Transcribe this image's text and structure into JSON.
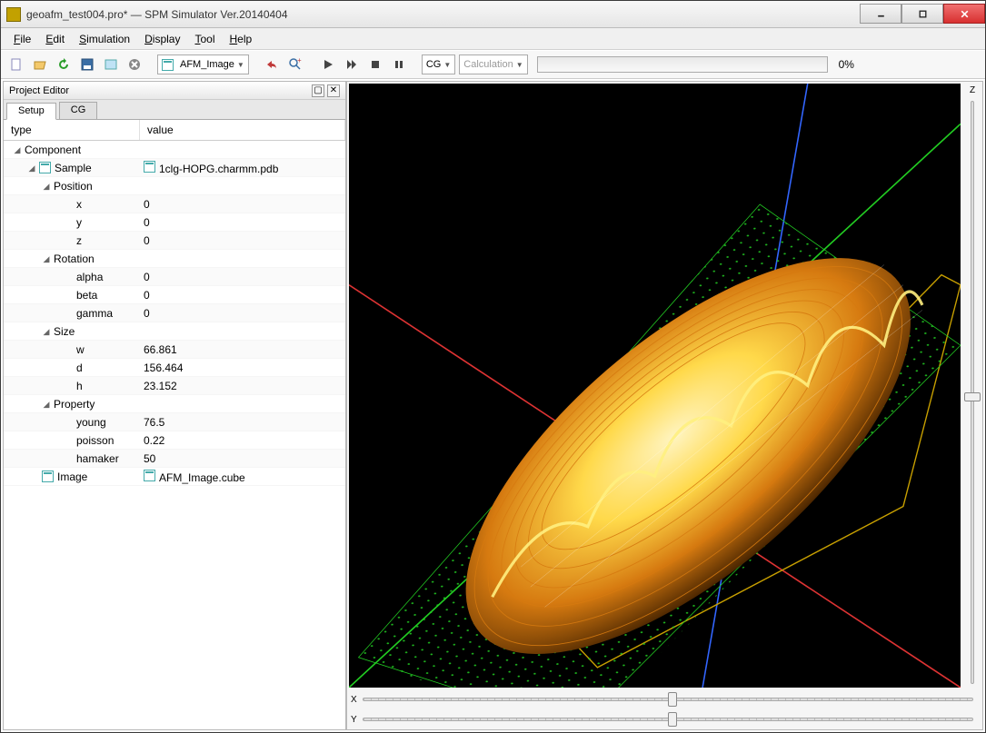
{
  "window": {
    "title": "geoafm_test004.pro* — SPM Simulator Ver.20140404"
  },
  "menu": {
    "file": "File",
    "edit": "Edit",
    "sim": "Simulation",
    "display": "Display",
    "tool": "Tool",
    "help": "Help"
  },
  "toolbar": {
    "combo1": "AFM_Image",
    "cg": "CG",
    "calc": "Calculation",
    "pct": "0%"
  },
  "editor": {
    "title": "Project Editor",
    "tabs": {
      "setup": "Setup",
      "cg": "CG"
    },
    "headers": {
      "type": "type",
      "value": "value"
    },
    "rows": {
      "component": "Component",
      "sample": "Sample",
      "sample_val": "1clg-HOPG.charmm.pdb",
      "position": "Position",
      "x": "x",
      "x_val": "0",
      "y": "y",
      "y_val": "0",
      "z": "z",
      "z_val": "0",
      "rotation": "Rotation",
      "alpha": "alpha",
      "alpha_val": "0",
      "beta": "beta",
      "beta_val": "0",
      "gamma": "gamma",
      "gamma_val": "0",
      "size": "Size",
      "w": "w",
      "w_val": "66.861",
      "d": "d",
      "d_val": "156.464",
      "h": "h",
      "h_val": "23.152",
      "property": "Property",
      "young": "young",
      "young_val": "76.5",
      "poisson": "poisson",
      "poisson_val": "0.22",
      "hamaker": "hamaker",
      "hamaker_val": "50",
      "image": "Image",
      "image_val": "AFM_Image.cube"
    }
  },
  "axes": {
    "x": "X",
    "y": "Y",
    "z": "Z"
  }
}
